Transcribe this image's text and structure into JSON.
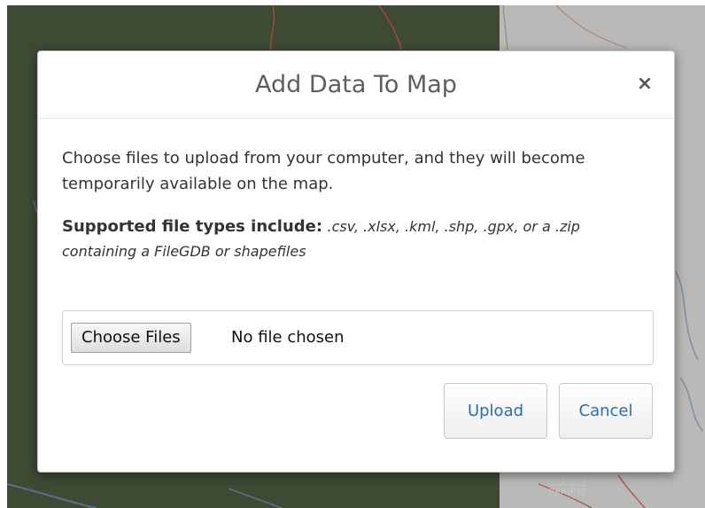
{
  "dialog": {
    "title": "Add Data To Map",
    "close_label": "×",
    "intro": "Choose files to upload from your computer, and they will become temporarily available on the map.",
    "supported_lead": "Supported file types include:",
    "supported_types": ".csv, .xlsx, .kml, .shp, .gpx, or a .zip containing a FileGDB or shapefiles",
    "file_input": {
      "button_label": "Choose Files",
      "status": "No file chosen"
    },
    "actions": {
      "upload_label": "Upload",
      "cancel_label": "Cancel"
    }
  },
  "map": {
    "town_label_line1": "GRANDE",
    "town_label_line2": "PRAIRIE"
  },
  "colors": {
    "link_blue": "#2a6fad",
    "map_dark": "#3f4a35",
    "map_light": "#b9b9b7"
  }
}
